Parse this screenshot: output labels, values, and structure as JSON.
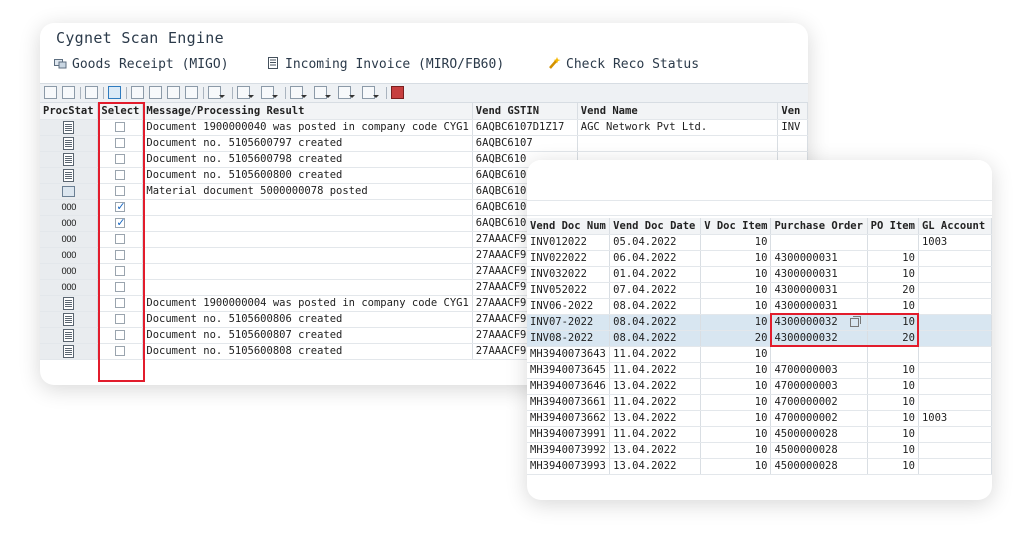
{
  "app": {
    "title": "Cygnet Scan Engine"
  },
  "menu": [
    {
      "label": "Goods Receipt (MIGO)",
      "icon": "goods-receipt-icon"
    },
    {
      "label": "Incoming Invoice (MIRO/FB60)",
      "icon": "invoice-icon"
    },
    {
      "label": "Check Reco Status",
      "icon": "wand-icon"
    }
  ],
  "table1": {
    "headers": [
      "ProcStat",
      "Select",
      "Message/Processing Result",
      "Vend GSTIN",
      "Vend Name",
      "Ven"
    ],
    "rows": [
      {
        "stat": "doc",
        "select": false,
        "msg": "Document 1900000040 was posted in company code CYG1",
        "gstin": "6AQBC6107D1Z17",
        "name": "AGC Network Pvt Ltd.",
        "ven": "INV"
      },
      {
        "stat": "doc",
        "select": false,
        "msg": "Document no. 5105600797 created",
        "gstin": "6AQBC6107",
        "name": "",
        "ven": ""
      },
      {
        "stat": "doc",
        "select": false,
        "msg": "Document no. 5105600798 created",
        "gstin": "6AQBC610",
        "name": "",
        "ven": ""
      },
      {
        "stat": "doc",
        "select": false,
        "msg": "Document no. 5105600800 created",
        "gstin": "6AQBC610",
        "name": "",
        "ven": ""
      },
      {
        "stat": "mat",
        "select": false,
        "msg": "Material document 5000000078 posted",
        "gstin": "6AQBC610",
        "name": "",
        "ven": ""
      },
      {
        "stat": "ooo",
        "select": true,
        "msg": "",
        "gstin": "6AQBC610",
        "name": "",
        "ven": ""
      },
      {
        "stat": "ooo",
        "select": true,
        "msg": "",
        "gstin": "6AQBC610",
        "name": "",
        "ven": ""
      },
      {
        "stat": "ooo",
        "select": false,
        "msg": "",
        "gstin": "27AAACF9",
        "name": "",
        "ven": ""
      },
      {
        "stat": "ooo",
        "select": false,
        "msg": "",
        "gstin": "27AAACF9",
        "name": "",
        "ven": ""
      },
      {
        "stat": "ooo",
        "select": false,
        "msg": "",
        "gstin": "27AAACF9",
        "name": "",
        "ven": ""
      },
      {
        "stat": "ooo",
        "select": false,
        "msg": "",
        "gstin": "27AAACF9",
        "name": "",
        "ven": ""
      },
      {
        "stat": "doc",
        "select": false,
        "msg": "Document 1900000004 was posted in company code CYG1",
        "gstin": "27AAACF9",
        "name": "",
        "ven": ""
      },
      {
        "stat": "doc",
        "select": false,
        "msg": "Document no. 5105600806 created",
        "gstin": "27AAACF9",
        "name": "",
        "ven": ""
      },
      {
        "stat": "doc",
        "select": false,
        "msg": "Document no. 5105600807 created",
        "gstin": "27AAACF9",
        "name": "",
        "ven": ""
      },
      {
        "stat": "doc",
        "select": false,
        "msg": "Document no. 5105600808 created",
        "gstin": "27AAACF9",
        "name": "",
        "ven": ""
      }
    ],
    "ooo_text": "OOO"
  },
  "table2": {
    "headers": [
      "Vend Doc Num",
      "Vend Doc Date",
      "V Doc Item",
      "Purchase Order",
      "PO Item",
      "GL Account"
    ],
    "rows": [
      {
        "num": "INV012022",
        "date": "05.04.2022",
        "item": "10",
        "po": "",
        "poitem": "",
        "gl": "1003",
        "hl": false
      },
      {
        "num": "INV022022",
        "date": "06.04.2022",
        "item": "10",
        "po": "4300000031",
        "poitem": "10",
        "gl": "",
        "hl": false
      },
      {
        "num": "INV032022",
        "date": "01.04.2022",
        "item": "10",
        "po": "4300000031",
        "poitem": "10",
        "gl": "",
        "hl": false
      },
      {
        "num": "INV052022",
        "date": "07.04.2022",
        "item": "10",
        "po": "4300000031",
        "poitem": "20",
        "gl": "",
        "hl": false
      },
      {
        "num": "INV06-2022",
        "date": "08.04.2022",
        "item": "10",
        "po": "4300000031",
        "poitem": "10",
        "gl": "",
        "hl": false
      },
      {
        "num": "INV07-2022",
        "date": "08.04.2022",
        "item": "10",
        "po": "4300000032",
        "poitem": "10",
        "gl": "",
        "hl": true
      },
      {
        "num": "INV08-2022",
        "date": "08.04.2022",
        "item": "20",
        "po": "4300000032",
        "poitem": "20",
        "gl": "",
        "hl": true
      },
      {
        "num": "MH3940073643",
        "date": "11.04.2022",
        "item": "10",
        "po": "",
        "poitem": "",
        "gl": "",
        "hl": false
      },
      {
        "num": "MH3940073645",
        "date": "11.04.2022",
        "item": "10",
        "po": "4700000003",
        "poitem": "10",
        "gl": "",
        "hl": false
      },
      {
        "num": "MH3940073646",
        "date": "13.04.2022",
        "item": "10",
        "po": "4700000003",
        "poitem": "10",
        "gl": "",
        "hl": false
      },
      {
        "num": "MH3940073661",
        "date": "11.04.2022",
        "item": "10",
        "po": "4700000002",
        "poitem": "10",
        "gl": "",
        "hl": false
      },
      {
        "num": "MH3940073662",
        "date": "13.04.2022",
        "item": "10",
        "po": "4700000002",
        "poitem": "10",
        "gl": "1003",
        "hl": false
      },
      {
        "num": "MH3940073991",
        "date": "11.04.2022",
        "item": "10",
        "po": "4500000028",
        "poitem": "10",
        "gl": "",
        "hl": false
      },
      {
        "num": "MH3940073992",
        "date": "13.04.2022",
        "item": "10",
        "po": "4500000028",
        "poitem": "10",
        "gl": "",
        "hl": false
      },
      {
        "num": "MH3940073993",
        "date": "13.04.2022",
        "item": "10",
        "po": "4500000028",
        "poitem": "10",
        "gl": "",
        "hl": false
      }
    ]
  },
  "colors": {
    "highlight_border": "#e21c2c",
    "highlight_row": "#d8e6f1",
    "check": "#1565c0"
  }
}
